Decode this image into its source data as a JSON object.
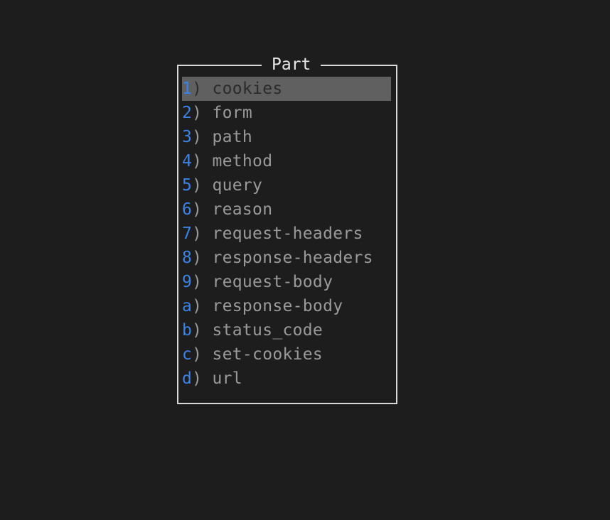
{
  "dialog": {
    "title": "Part",
    "selected_index": 0,
    "items": [
      {
        "key": "1",
        "label": "cookies"
      },
      {
        "key": "2",
        "label": "form"
      },
      {
        "key": "3",
        "label": "path"
      },
      {
        "key": "4",
        "label": "method"
      },
      {
        "key": "5",
        "label": "query"
      },
      {
        "key": "6",
        "label": "reason"
      },
      {
        "key": "7",
        "label": "request-headers"
      },
      {
        "key": "8",
        "label": "response-headers"
      },
      {
        "key": "9",
        "label": "request-body"
      },
      {
        "key": "a",
        "label": "response-body"
      },
      {
        "key": "b",
        "label": "status_code"
      },
      {
        "key": "c",
        "label": "set-cookies"
      },
      {
        "key": "d",
        "label": "url"
      }
    ]
  },
  "colors": {
    "background": "#1d1d1d",
    "border": "#d8d8d8",
    "key": "#3b82e6",
    "label": "#9a9a9a",
    "highlight": "#606060"
  }
}
